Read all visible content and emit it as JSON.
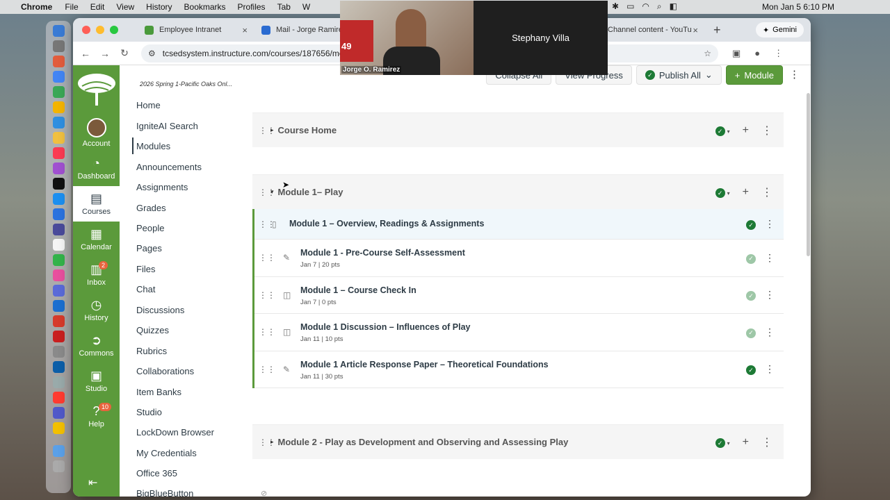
{
  "menubar": {
    "app_name": "Chrome",
    "menus": [
      "File",
      "Edit",
      "View",
      "History",
      "Bookmarks",
      "Profiles",
      "Tab",
      "W"
    ],
    "clock": "Mon Jan 5  6:10 PM"
  },
  "browser": {
    "tabs": [
      {
        "label": "Employee Intranet",
        "favicon_color": "#4a9a3b"
      },
      {
        "label": "Mail - Jorge Ramirez - O",
        "favicon_color": "#2a6bd1"
      },
      {
        "label": "Channel content - YouTu",
        "favicon_color": "#e00000"
      }
    ],
    "gemini_label": "Gemini",
    "url": "tcsedsystem.instructure.com/courses/187656/mo"
  },
  "video_call": {
    "participant1": "Jorge O. Ramirez",
    "participant2": "Stephany Villa",
    "banner_text": "49"
  },
  "global_nav": {
    "items": [
      {
        "label": "Account",
        "icon": "avatar"
      },
      {
        "label": "Dashboard",
        "icon": "dashboard-icon"
      },
      {
        "label": "Courses",
        "icon": "book-icon"
      },
      {
        "label": "Calendar",
        "icon": "calendar-icon"
      },
      {
        "label": "Inbox",
        "icon": "inbox-icon",
        "badge": "2"
      },
      {
        "label": "History",
        "icon": "clock-icon"
      },
      {
        "label": "Commons",
        "icon": "commons-icon"
      },
      {
        "label": "Studio",
        "icon": "studio-icon"
      },
      {
        "label": "Help",
        "icon": "help-icon",
        "badge": "10"
      }
    ]
  },
  "course_nav": {
    "breadcrumb": "2026 Spring 1-Pacific Oaks Onl...",
    "items": [
      "Home",
      "IgniteAI Search",
      "Modules",
      "Announcements",
      "Assignments",
      "Grades",
      "People",
      "Pages",
      "Files",
      "Chat",
      "Discussions",
      "Quizzes",
      "Rubrics",
      "Collaborations",
      "Item Banks",
      "Studio",
      "LockDown Browser",
      "My Credentials",
      "Office 365",
      "BigBlueButton"
    ],
    "active": "Modules"
  },
  "toolbar": {
    "collapse_label": "Collapse All",
    "progress_label": "View Progress",
    "publish_all_label": "Publish All",
    "module_label": "Module"
  },
  "modules": {
    "course_home": "Course Home",
    "module1": "Module 1– Play",
    "module2": "Module 2 - Play as Development and Observing and Assessing Play",
    "items": [
      {
        "title": "Module 1 – Overview, Readings & Assignments",
        "meta": "",
        "type": "page"
      },
      {
        "title": "Module 1 - Pre-Course Self-Assessment",
        "meta": "Jan 7  |  20 pts",
        "type": "assignment"
      },
      {
        "title": "Module 1 – Course Check In",
        "meta": "Jan 7  |  0 pts",
        "type": "discussion"
      },
      {
        "title": "Module 1 Discussion – Influences of Play",
        "meta": "Jan 11  |  10 pts",
        "type": "discussion"
      },
      {
        "title": "Module 1 Article Response Paper – Theoretical Foundations",
        "meta": "Jan 11  |  30 pts",
        "type": "assignment"
      }
    ]
  },
  "colors": {
    "canvas_green": "#5b9a3b",
    "published_green": "#1d7a35"
  }
}
